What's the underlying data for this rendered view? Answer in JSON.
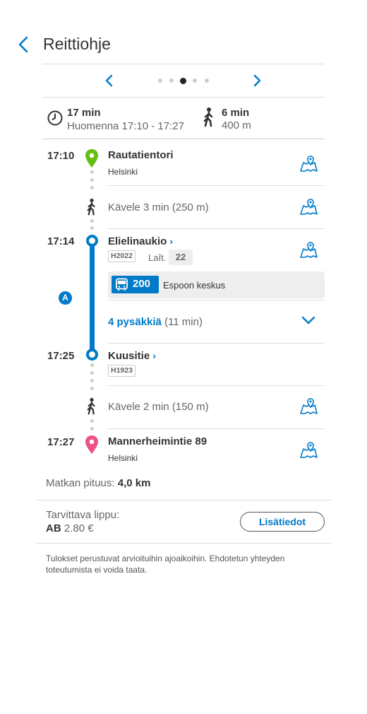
{
  "header": {
    "title": "Reittiohje"
  },
  "pager": {
    "dots": 5,
    "active_index": 2
  },
  "summary": {
    "duration": "17 min",
    "time_range": "Huomenna 17:10 - 17:27",
    "walk_duration": "6 min",
    "walk_distance": "400 m"
  },
  "legs": {
    "start": {
      "time": "17:10",
      "name": "Rautatientori",
      "city": "Helsinki"
    },
    "walk1": {
      "text": "Kävele 3 min (250 m)"
    },
    "board": {
      "time": "17:14",
      "name": "Elielinaukio",
      "code": "H2022",
      "platform_label": "Laît.",
      "platform": "22"
    },
    "vehicle": {
      "route": "200",
      "destination": "Espoon keskus",
      "mode_letter": "A"
    },
    "stops": {
      "count_text": "4 pysäkkiä",
      "duration_text": "(11 min)"
    },
    "alight": {
      "time": "17:25",
      "name": "Kuusitie",
      "code": "H1923"
    },
    "walk2": {
      "text": "Kävele 2 min (150 m)"
    },
    "end": {
      "time": "17:27",
      "name": "Mannerheimintie 89",
      "city": "Helsinki"
    }
  },
  "trip_length": {
    "label": "Matkan pituus:",
    "value": "4,0 km"
  },
  "ticket": {
    "label": "Tarvittava lippu:",
    "zone": "AB",
    "price": "2.80 €",
    "button": "Lisätiedot"
  },
  "disclaimer": "Tulokset perustuvat arvioituihin ajoaikoihin. Ehdotetun yhteyden toteutumista ei voida taata.",
  "colors": {
    "accent": "#007ac9",
    "origin": "#64be14",
    "destination": "#ec5188",
    "text": "#333333",
    "muted": "#666666"
  }
}
